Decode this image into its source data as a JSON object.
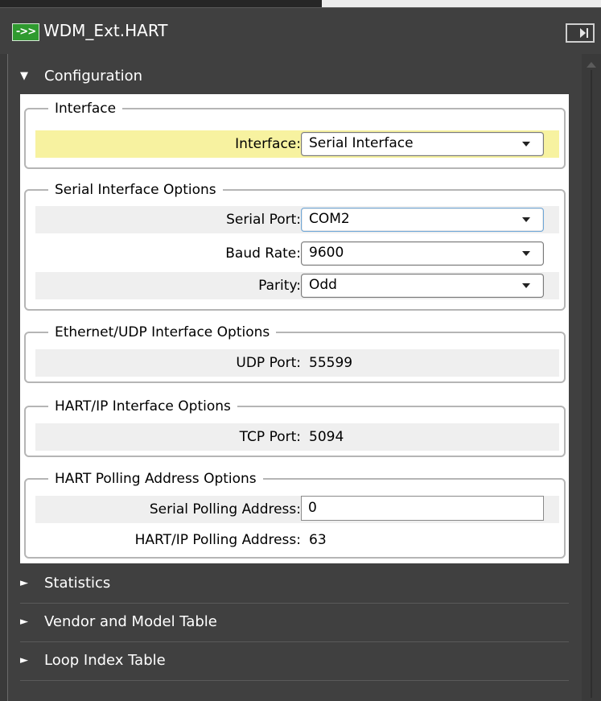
{
  "window": {
    "title": "WDM_Ext.HART",
    "app_icon": "->>"
  },
  "sections": {
    "configuration": "Configuration",
    "statistics": "Statistics",
    "vendor_model": "Vendor and Model Table",
    "loop_index": "Loop Index Table"
  },
  "interface_group": {
    "legend": "Interface",
    "interface_label": "Interface:",
    "interface_value": "Serial Interface"
  },
  "serial_group": {
    "legend": "Serial Interface Options",
    "port_label": "Serial Port:",
    "port_value": "COM2",
    "baud_label": "Baud Rate:",
    "baud_value": "9600",
    "parity_label": "Parity:",
    "parity_value": "Odd"
  },
  "ethernet_group": {
    "legend": "Ethernet/UDP Interface Options",
    "udp_label": "UDP Port:",
    "udp_value": "55599"
  },
  "hartip_group": {
    "legend": "HART/IP Interface Options",
    "tcp_label": "TCP Port:",
    "tcp_value": "5094"
  },
  "polling_group": {
    "legend": "HART Polling Address Options",
    "serial_label": "Serial Polling Address:",
    "serial_value": "0",
    "hartip_label": "HART/IP Polling Address:",
    "hartip_value": "63"
  },
  "icons": {
    "expanded": "▼",
    "collapsed": "►"
  },
  "colors": {
    "highlight_row": "#f7f2a0",
    "panel_bg": "#404040",
    "app_icon": "#2f9a2f"
  }
}
